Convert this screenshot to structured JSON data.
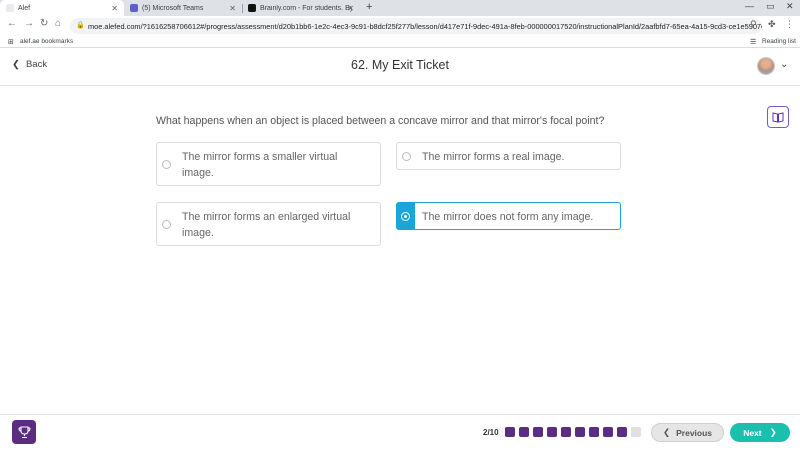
{
  "browser": {
    "tabs": [
      {
        "label": "Alef"
      },
      {
        "label": "(5) Microsoft Teams"
      },
      {
        "label": "Brainly.com - For students. By st"
      }
    ],
    "url": "moe.alefed.com/?1616258706612#/progress/assessment/d20b1bb6-1e2c-4ec3-9c91-b8dcf25f277b/lesson/d417e71f-9dec-491a-8feb-000000017520/instructionalPlanId/2aafbfd7-65ea-4a15-9cd3-ce1e5907c2...",
    "bookmark": "alef.ae bookmarks",
    "reading_list": "Reading list"
  },
  "header": {
    "back_label": "Back",
    "title": "62. My Exit Ticket"
  },
  "question": "What happens when an object is placed between a concave mirror and that mirror's focal point?",
  "options": [
    {
      "line1": "The mirror forms a smaller virtual",
      "line2": "image.",
      "selected": false
    },
    {
      "line1": "The mirror forms a real image.",
      "line2": "",
      "selected": false
    },
    {
      "line1": "The mirror forms an enlarged virtual",
      "line2": "image.",
      "selected": false
    },
    {
      "line1": "The mirror does not form any image.",
      "line2": "",
      "selected": true
    }
  ],
  "footer": {
    "progress": "2/10",
    "filled_steps": 9,
    "total_steps": 10,
    "previous_label": "Previous",
    "next_label": "Next"
  },
  "colors": {
    "accent_purple": "#5a2d82",
    "selected_blue": "#1aa6d8",
    "next_teal": "#1bbfae"
  }
}
